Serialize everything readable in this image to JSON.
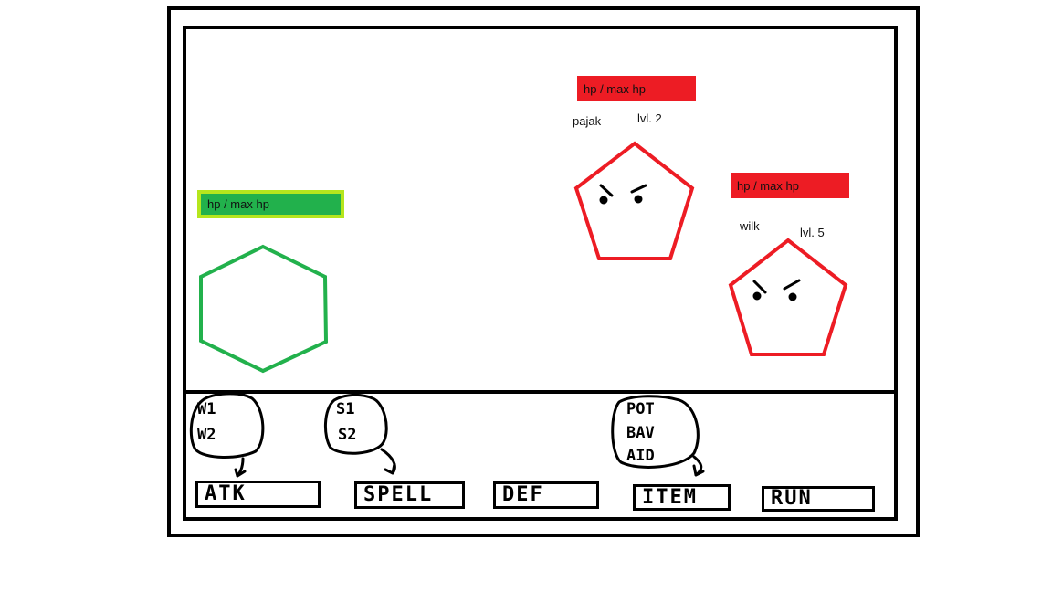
{
  "player": {
    "hp_label": "hp  /  max hp",
    "colors": {
      "bar_fill": "#22b14c",
      "bar_border": "#b5e61d",
      "outline": "#22b14c"
    }
  },
  "enemies": [
    {
      "name": "pajak",
      "level": "lvl. 2",
      "hp_label": "hp  /  max hp"
    },
    {
      "name": "wilk",
      "level": "lvl. 5",
      "hp_label": "hp  /  max hp"
    }
  ],
  "enemy_colors": {
    "bar_fill": "#ed1c24",
    "outline": "#ed1c24"
  },
  "menu": {
    "buttons": [
      {
        "label": "ATK"
      },
      {
        "label": "SPELL"
      },
      {
        "label": "DEF"
      },
      {
        "label": "ITEM"
      },
      {
        "label": "RUN"
      }
    ],
    "submenus": {
      "atk": [
        "W1",
        "W2"
      ],
      "spell": [
        "S1",
        "S2"
      ],
      "item": [
        "POT",
        "BAV",
        "AID"
      ]
    }
  }
}
